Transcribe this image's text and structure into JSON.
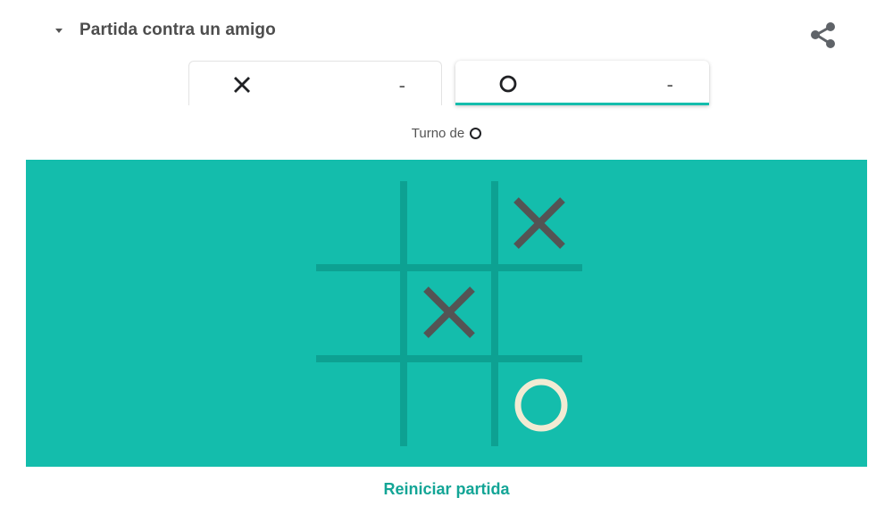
{
  "header": {
    "mode_label": "Partida contra un amigo",
    "share_icon": "share-icon"
  },
  "scoreboard": {
    "player_x": {
      "symbol": "X",
      "score": "-"
    },
    "player_o": {
      "symbol": "O",
      "score": "-",
      "active": true
    }
  },
  "turn": {
    "label": "Turno de",
    "player": "O"
  },
  "board": {
    "cells": [
      [
        "",
        "",
        "X"
      ],
      [
        "",
        "X",
        ""
      ],
      [
        "",
        "",
        "O"
      ]
    ]
  },
  "actions": {
    "restart_label": "Reiniciar partida"
  },
  "colors": {
    "board_background": "#14bdac",
    "grid_line": "#0da192",
    "x_mark": "#545454",
    "o_mark": "#f2ebd3",
    "accent": "#13a596"
  }
}
